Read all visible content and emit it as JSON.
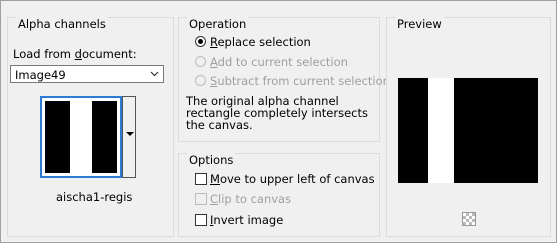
{
  "alpha": {
    "title": "Alpha channels",
    "load_label_pre": "Load from ",
    "load_label_ul": "d",
    "load_label_post": "ocument:",
    "document_value": "Image49",
    "channel_name": "aischa1-regis"
  },
  "operation": {
    "title": "Operation",
    "replace_ul": "R",
    "replace_rest": "eplace selection",
    "add_ul": "A",
    "add_rest": "dd to current selection",
    "subtract_ul": "S",
    "subtract_rest": "ubtract from current selection",
    "description": "The original alpha channel rectangle completely intersects the canvas."
  },
  "options": {
    "title": "Options",
    "move_ul": "M",
    "move_rest": "ove to upper left of canvas",
    "clip_ul": "C",
    "clip_rest": "lip to canvas",
    "invert_ul": "I",
    "invert_rest": "nvert image"
  },
  "preview": {
    "title": "Preview"
  }
}
